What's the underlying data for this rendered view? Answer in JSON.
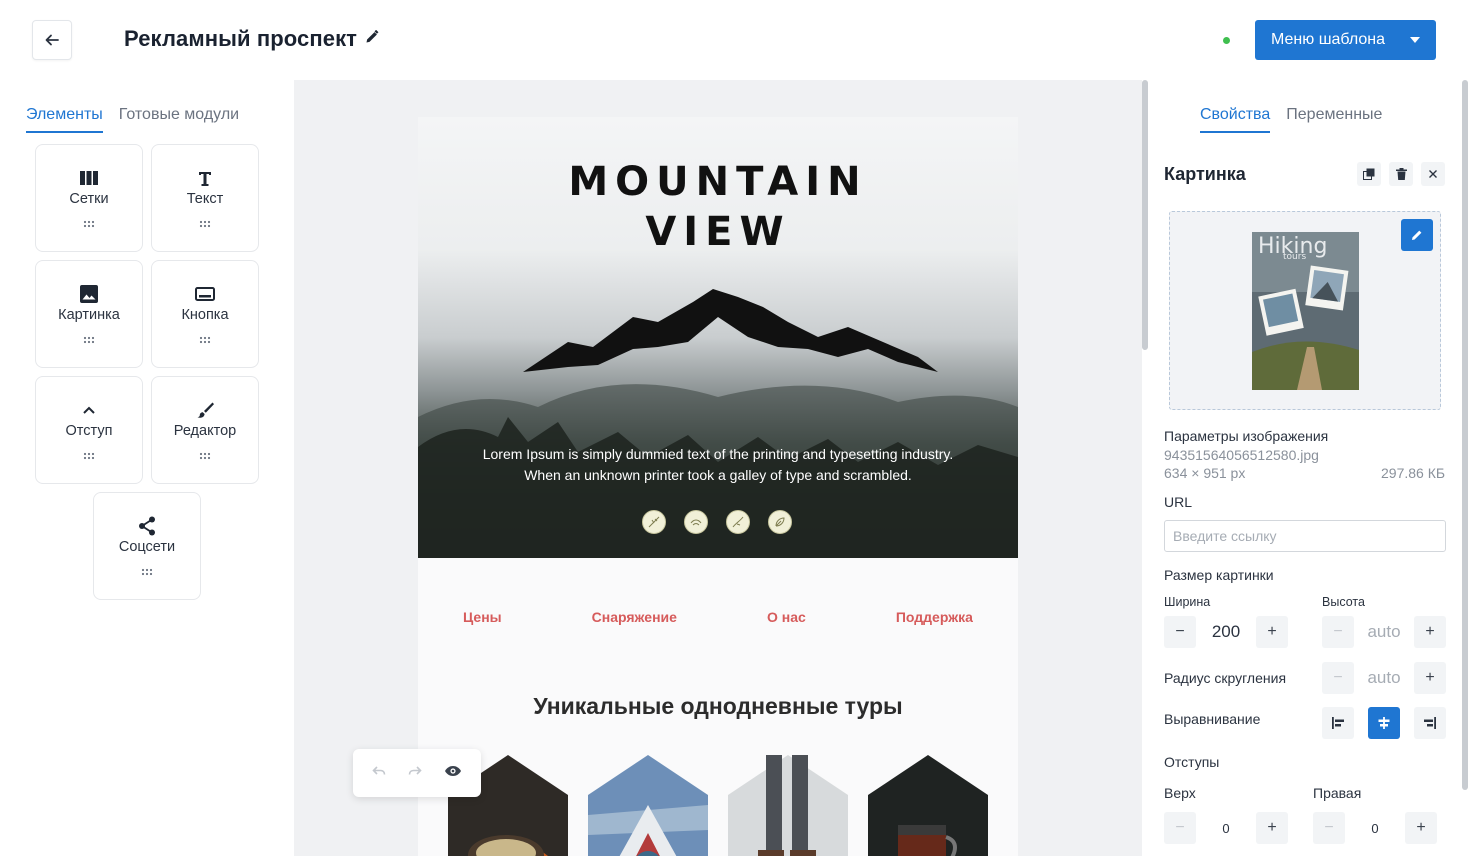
{
  "header": {
    "title": "Рекламный проспект",
    "menu_label": "Меню шаблона"
  },
  "left_panel": {
    "tabs": [
      "Элементы",
      "Готовые модули"
    ],
    "elements": [
      {
        "label": "Сетки",
        "icon": "columns-icon"
      },
      {
        "label": "Текст",
        "icon": "text-icon"
      },
      {
        "label": "Картинка",
        "icon": "image-icon"
      },
      {
        "label": "Кнопка",
        "icon": "button-icon"
      },
      {
        "label": "Отступ",
        "icon": "spacer-icon"
      },
      {
        "label": "Редактор",
        "icon": "brush-icon"
      },
      {
        "label": "Соцсети",
        "icon": "share-icon"
      }
    ]
  },
  "canvas": {
    "hero_title_1": "MOUNTAIN",
    "hero_title_2": "VIEW",
    "hero_text_1": "Lorem Ipsum is simply dummied text of the printing and typesetting industry.",
    "hero_text_2": "When an unknown printer took a galley of type and scrambled.",
    "nav": [
      "Цены",
      "Снаряжение",
      "О нас",
      "Поддержка"
    ],
    "section_title": "Уникальные однодневные туры"
  },
  "right_panel": {
    "tabs": [
      "Свойства",
      "Переменные"
    ],
    "section_title": "Картинка",
    "thumb_text_1": "Hiking",
    "thumb_text_2": "tours",
    "image_params_label": "Параметры изображения",
    "file_name": "94351564056512580.jpg",
    "dimensions": "634 × 951 px",
    "file_size": "297.86 КБ",
    "url_label": "URL",
    "url_placeholder": "Введите ссылку",
    "size_label": "Размер картинки",
    "width_label": "Ширина",
    "height_label": "Высота",
    "width_value": "200",
    "height_value": "auto",
    "radius_label": "Радиус скругления",
    "radius_value": "auto",
    "align_label": "Выравнивание",
    "padding_label": "Отступы",
    "top_label": "Верх",
    "right_label": "Правая",
    "top_value": "0",
    "right_value": "0"
  },
  "colors": {
    "accent": "#1f76d2",
    "status_online": "#3fbf4f",
    "nav_link": "#d65b5b"
  }
}
